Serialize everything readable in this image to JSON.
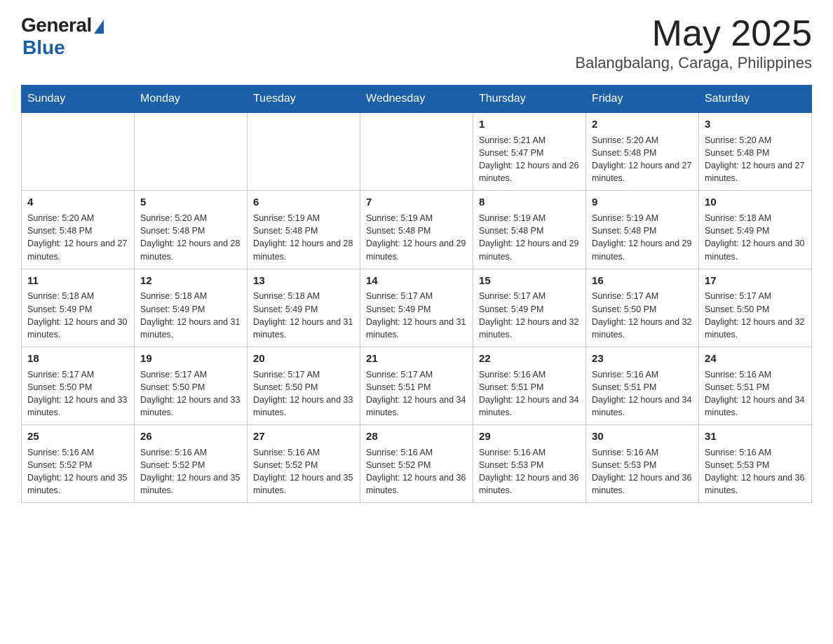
{
  "header": {
    "logo": {
      "general": "General",
      "blue": "Blue"
    },
    "title": "May 2025",
    "location": "Balangbalang, Caraga, Philippines"
  },
  "calendar": {
    "days_of_week": [
      "Sunday",
      "Monday",
      "Tuesday",
      "Wednesday",
      "Thursday",
      "Friday",
      "Saturday"
    ],
    "weeks": [
      {
        "days": [
          {
            "number": "",
            "info": ""
          },
          {
            "number": "",
            "info": ""
          },
          {
            "number": "",
            "info": ""
          },
          {
            "number": "",
            "info": ""
          },
          {
            "number": "1",
            "info": "Sunrise: 5:21 AM\nSunset: 5:47 PM\nDaylight: 12 hours and 26 minutes."
          },
          {
            "number": "2",
            "info": "Sunrise: 5:20 AM\nSunset: 5:48 PM\nDaylight: 12 hours and 27 minutes."
          },
          {
            "number": "3",
            "info": "Sunrise: 5:20 AM\nSunset: 5:48 PM\nDaylight: 12 hours and 27 minutes."
          }
        ]
      },
      {
        "days": [
          {
            "number": "4",
            "info": "Sunrise: 5:20 AM\nSunset: 5:48 PM\nDaylight: 12 hours and 27 minutes."
          },
          {
            "number": "5",
            "info": "Sunrise: 5:20 AM\nSunset: 5:48 PM\nDaylight: 12 hours and 28 minutes."
          },
          {
            "number": "6",
            "info": "Sunrise: 5:19 AM\nSunset: 5:48 PM\nDaylight: 12 hours and 28 minutes."
          },
          {
            "number": "7",
            "info": "Sunrise: 5:19 AM\nSunset: 5:48 PM\nDaylight: 12 hours and 29 minutes."
          },
          {
            "number": "8",
            "info": "Sunrise: 5:19 AM\nSunset: 5:48 PM\nDaylight: 12 hours and 29 minutes."
          },
          {
            "number": "9",
            "info": "Sunrise: 5:19 AM\nSunset: 5:48 PM\nDaylight: 12 hours and 29 minutes."
          },
          {
            "number": "10",
            "info": "Sunrise: 5:18 AM\nSunset: 5:49 PM\nDaylight: 12 hours and 30 minutes."
          }
        ]
      },
      {
        "days": [
          {
            "number": "11",
            "info": "Sunrise: 5:18 AM\nSunset: 5:49 PM\nDaylight: 12 hours and 30 minutes."
          },
          {
            "number": "12",
            "info": "Sunrise: 5:18 AM\nSunset: 5:49 PM\nDaylight: 12 hours and 31 minutes."
          },
          {
            "number": "13",
            "info": "Sunrise: 5:18 AM\nSunset: 5:49 PM\nDaylight: 12 hours and 31 minutes."
          },
          {
            "number": "14",
            "info": "Sunrise: 5:17 AM\nSunset: 5:49 PM\nDaylight: 12 hours and 31 minutes."
          },
          {
            "number": "15",
            "info": "Sunrise: 5:17 AM\nSunset: 5:49 PM\nDaylight: 12 hours and 32 minutes."
          },
          {
            "number": "16",
            "info": "Sunrise: 5:17 AM\nSunset: 5:50 PM\nDaylight: 12 hours and 32 minutes."
          },
          {
            "number": "17",
            "info": "Sunrise: 5:17 AM\nSunset: 5:50 PM\nDaylight: 12 hours and 32 minutes."
          }
        ]
      },
      {
        "days": [
          {
            "number": "18",
            "info": "Sunrise: 5:17 AM\nSunset: 5:50 PM\nDaylight: 12 hours and 33 minutes."
          },
          {
            "number": "19",
            "info": "Sunrise: 5:17 AM\nSunset: 5:50 PM\nDaylight: 12 hours and 33 minutes."
          },
          {
            "number": "20",
            "info": "Sunrise: 5:17 AM\nSunset: 5:50 PM\nDaylight: 12 hours and 33 minutes."
          },
          {
            "number": "21",
            "info": "Sunrise: 5:17 AM\nSunset: 5:51 PM\nDaylight: 12 hours and 34 minutes."
          },
          {
            "number": "22",
            "info": "Sunrise: 5:16 AM\nSunset: 5:51 PM\nDaylight: 12 hours and 34 minutes."
          },
          {
            "number": "23",
            "info": "Sunrise: 5:16 AM\nSunset: 5:51 PM\nDaylight: 12 hours and 34 minutes."
          },
          {
            "number": "24",
            "info": "Sunrise: 5:16 AM\nSunset: 5:51 PM\nDaylight: 12 hours and 34 minutes."
          }
        ]
      },
      {
        "days": [
          {
            "number": "25",
            "info": "Sunrise: 5:16 AM\nSunset: 5:52 PM\nDaylight: 12 hours and 35 minutes."
          },
          {
            "number": "26",
            "info": "Sunrise: 5:16 AM\nSunset: 5:52 PM\nDaylight: 12 hours and 35 minutes."
          },
          {
            "number": "27",
            "info": "Sunrise: 5:16 AM\nSunset: 5:52 PM\nDaylight: 12 hours and 35 minutes."
          },
          {
            "number": "28",
            "info": "Sunrise: 5:16 AM\nSunset: 5:52 PM\nDaylight: 12 hours and 36 minutes."
          },
          {
            "number": "29",
            "info": "Sunrise: 5:16 AM\nSunset: 5:53 PM\nDaylight: 12 hours and 36 minutes."
          },
          {
            "number": "30",
            "info": "Sunrise: 5:16 AM\nSunset: 5:53 PM\nDaylight: 12 hours and 36 minutes."
          },
          {
            "number": "31",
            "info": "Sunrise: 5:16 AM\nSunset: 5:53 PM\nDaylight: 12 hours and 36 minutes."
          }
        ]
      }
    ]
  }
}
